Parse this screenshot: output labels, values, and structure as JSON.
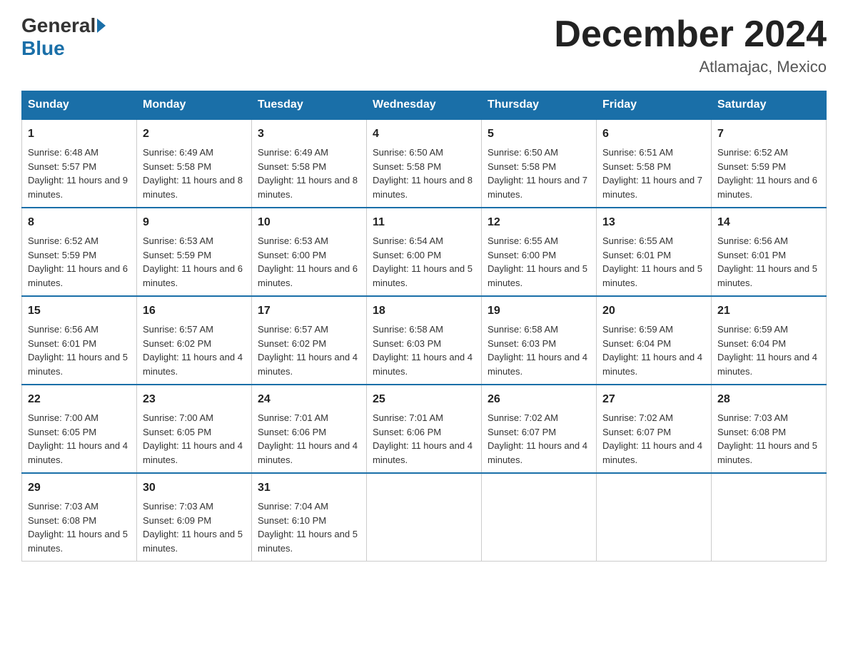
{
  "header": {
    "logo": {
      "general": "General",
      "blue": "Blue"
    },
    "title": "December 2024",
    "location": "Atlamajac, Mexico"
  },
  "days_of_week": [
    "Sunday",
    "Monday",
    "Tuesday",
    "Wednesday",
    "Thursday",
    "Friday",
    "Saturday"
  ],
  "weeks": [
    [
      {
        "day": "1",
        "sunrise": "6:48 AM",
        "sunset": "5:57 PM",
        "daylight": "11 hours and 9 minutes."
      },
      {
        "day": "2",
        "sunrise": "6:49 AM",
        "sunset": "5:58 PM",
        "daylight": "11 hours and 8 minutes."
      },
      {
        "day": "3",
        "sunrise": "6:49 AM",
        "sunset": "5:58 PM",
        "daylight": "11 hours and 8 minutes."
      },
      {
        "day": "4",
        "sunrise": "6:50 AM",
        "sunset": "5:58 PM",
        "daylight": "11 hours and 8 minutes."
      },
      {
        "day": "5",
        "sunrise": "6:50 AM",
        "sunset": "5:58 PM",
        "daylight": "11 hours and 7 minutes."
      },
      {
        "day": "6",
        "sunrise": "6:51 AM",
        "sunset": "5:58 PM",
        "daylight": "11 hours and 7 minutes."
      },
      {
        "day": "7",
        "sunrise": "6:52 AM",
        "sunset": "5:59 PM",
        "daylight": "11 hours and 6 minutes."
      }
    ],
    [
      {
        "day": "8",
        "sunrise": "6:52 AM",
        "sunset": "5:59 PM",
        "daylight": "11 hours and 6 minutes."
      },
      {
        "day": "9",
        "sunrise": "6:53 AM",
        "sunset": "5:59 PM",
        "daylight": "11 hours and 6 minutes."
      },
      {
        "day": "10",
        "sunrise": "6:53 AM",
        "sunset": "6:00 PM",
        "daylight": "11 hours and 6 minutes."
      },
      {
        "day": "11",
        "sunrise": "6:54 AM",
        "sunset": "6:00 PM",
        "daylight": "11 hours and 5 minutes."
      },
      {
        "day": "12",
        "sunrise": "6:55 AM",
        "sunset": "6:00 PM",
        "daylight": "11 hours and 5 minutes."
      },
      {
        "day": "13",
        "sunrise": "6:55 AM",
        "sunset": "6:01 PM",
        "daylight": "11 hours and 5 minutes."
      },
      {
        "day": "14",
        "sunrise": "6:56 AM",
        "sunset": "6:01 PM",
        "daylight": "11 hours and 5 minutes."
      }
    ],
    [
      {
        "day": "15",
        "sunrise": "6:56 AM",
        "sunset": "6:01 PM",
        "daylight": "11 hours and 5 minutes."
      },
      {
        "day": "16",
        "sunrise": "6:57 AM",
        "sunset": "6:02 PM",
        "daylight": "11 hours and 4 minutes."
      },
      {
        "day": "17",
        "sunrise": "6:57 AM",
        "sunset": "6:02 PM",
        "daylight": "11 hours and 4 minutes."
      },
      {
        "day": "18",
        "sunrise": "6:58 AM",
        "sunset": "6:03 PM",
        "daylight": "11 hours and 4 minutes."
      },
      {
        "day": "19",
        "sunrise": "6:58 AM",
        "sunset": "6:03 PM",
        "daylight": "11 hours and 4 minutes."
      },
      {
        "day": "20",
        "sunrise": "6:59 AM",
        "sunset": "6:04 PM",
        "daylight": "11 hours and 4 minutes."
      },
      {
        "day": "21",
        "sunrise": "6:59 AM",
        "sunset": "6:04 PM",
        "daylight": "11 hours and 4 minutes."
      }
    ],
    [
      {
        "day": "22",
        "sunrise": "7:00 AM",
        "sunset": "6:05 PM",
        "daylight": "11 hours and 4 minutes."
      },
      {
        "day": "23",
        "sunrise": "7:00 AM",
        "sunset": "6:05 PM",
        "daylight": "11 hours and 4 minutes."
      },
      {
        "day": "24",
        "sunrise": "7:01 AM",
        "sunset": "6:06 PM",
        "daylight": "11 hours and 4 minutes."
      },
      {
        "day": "25",
        "sunrise": "7:01 AM",
        "sunset": "6:06 PM",
        "daylight": "11 hours and 4 minutes."
      },
      {
        "day": "26",
        "sunrise": "7:02 AM",
        "sunset": "6:07 PM",
        "daylight": "11 hours and 4 minutes."
      },
      {
        "day": "27",
        "sunrise": "7:02 AM",
        "sunset": "6:07 PM",
        "daylight": "11 hours and 4 minutes."
      },
      {
        "day": "28",
        "sunrise": "7:03 AM",
        "sunset": "6:08 PM",
        "daylight": "11 hours and 5 minutes."
      }
    ],
    [
      {
        "day": "29",
        "sunrise": "7:03 AM",
        "sunset": "6:08 PM",
        "daylight": "11 hours and 5 minutes."
      },
      {
        "day": "30",
        "sunrise": "7:03 AM",
        "sunset": "6:09 PM",
        "daylight": "11 hours and 5 minutes."
      },
      {
        "day": "31",
        "sunrise": "7:04 AM",
        "sunset": "6:10 PM",
        "daylight": "11 hours and 5 minutes."
      },
      null,
      null,
      null,
      null
    ]
  ]
}
